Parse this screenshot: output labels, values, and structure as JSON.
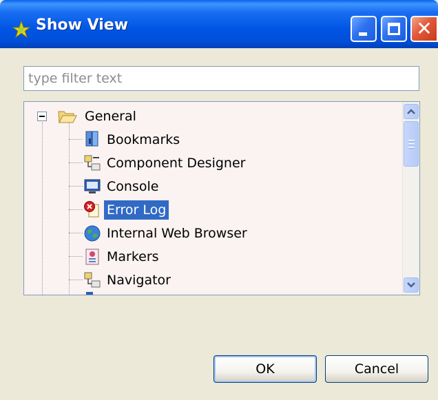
{
  "window": {
    "title": "Show View",
    "title_icon": "star-icon"
  },
  "titlebar_buttons": {
    "minimize_icon": "minimize-icon",
    "maximize_icon": "maximize-icon",
    "close_icon": "close-icon",
    "close_glyph": "✕"
  },
  "filter": {
    "placeholder": "type filter text"
  },
  "tree": {
    "root": {
      "label": "General",
      "icon": "folder-open-icon",
      "expanded": true
    },
    "items": [
      {
        "label": "Bookmarks",
        "icon": "bookmarks-icon"
      },
      {
        "label": "Component Designer",
        "icon": "component-designer-icon"
      },
      {
        "label": "Console",
        "icon": "console-icon"
      },
      {
        "label": "Error Log",
        "icon": "error-log-icon",
        "selected": true
      },
      {
        "label": "Internal Web Browser",
        "icon": "globe-icon"
      },
      {
        "label": "Markers",
        "icon": "markers-icon"
      },
      {
        "label": "Navigator",
        "icon": "navigator-icon"
      }
    ]
  },
  "buttons": {
    "ok": "OK",
    "cancel": "Cancel"
  },
  "colors": {
    "titlebar": "#0055e5",
    "selection": "#316ac5",
    "dialog_bg": "#ece9d8",
    "tree_bg": "#fbf2f2"
  }
}
